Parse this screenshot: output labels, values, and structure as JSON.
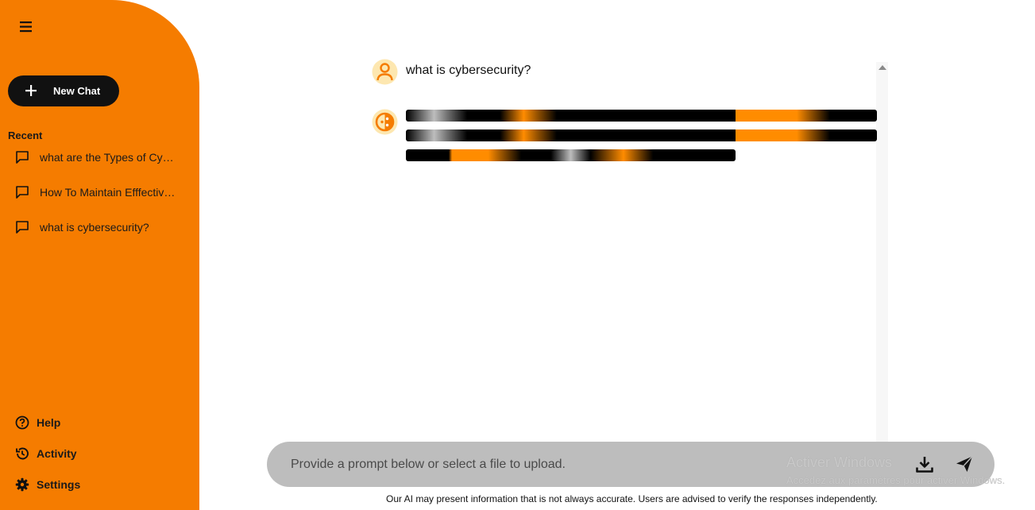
{
  "sidebar": {
    "new_chat_label": "New Chat",
    "recent_title": "Recent",
    "recent_items": [
      {
        "label": "what are the Types of Cybersecurity?",
        "icon": "chat-bubble-icon"
      },
      {
        "label": "How To Maintain Efffective Cybersecurity?",
        "icon": "chat-bubble-icon"
      },
      {
        "label": "what is cybersecurity?",
        "icon": "chat-bubble-icon"
      }
    ],
    "bottom_items": [
      {
        "label": "Help",
        "icon": "help-circle-icon"
      },
      {
        "label": "Activity",
        "icon": "history-icon"
      },
      {
        "label": "Settings",
        "icon": "gear-icon"
      }
    ],
    "color": "#f57c00"
  },
  "chat": {
    "user_message": "what is cybersecurity?",
    "bot_status": "loading"
  },
  "prompt": {
    "placeholder": "Provide a prompt below or select a file to upload."
  },
  "watermark": {
    "title": "Activer Windows",
    "subtitle": "Accédez aux paramètres pour activer Windows."
  },
  "disclaimer": "Our AI may present information that is not always accurate. Users are advised to verify the responses independently."
}
